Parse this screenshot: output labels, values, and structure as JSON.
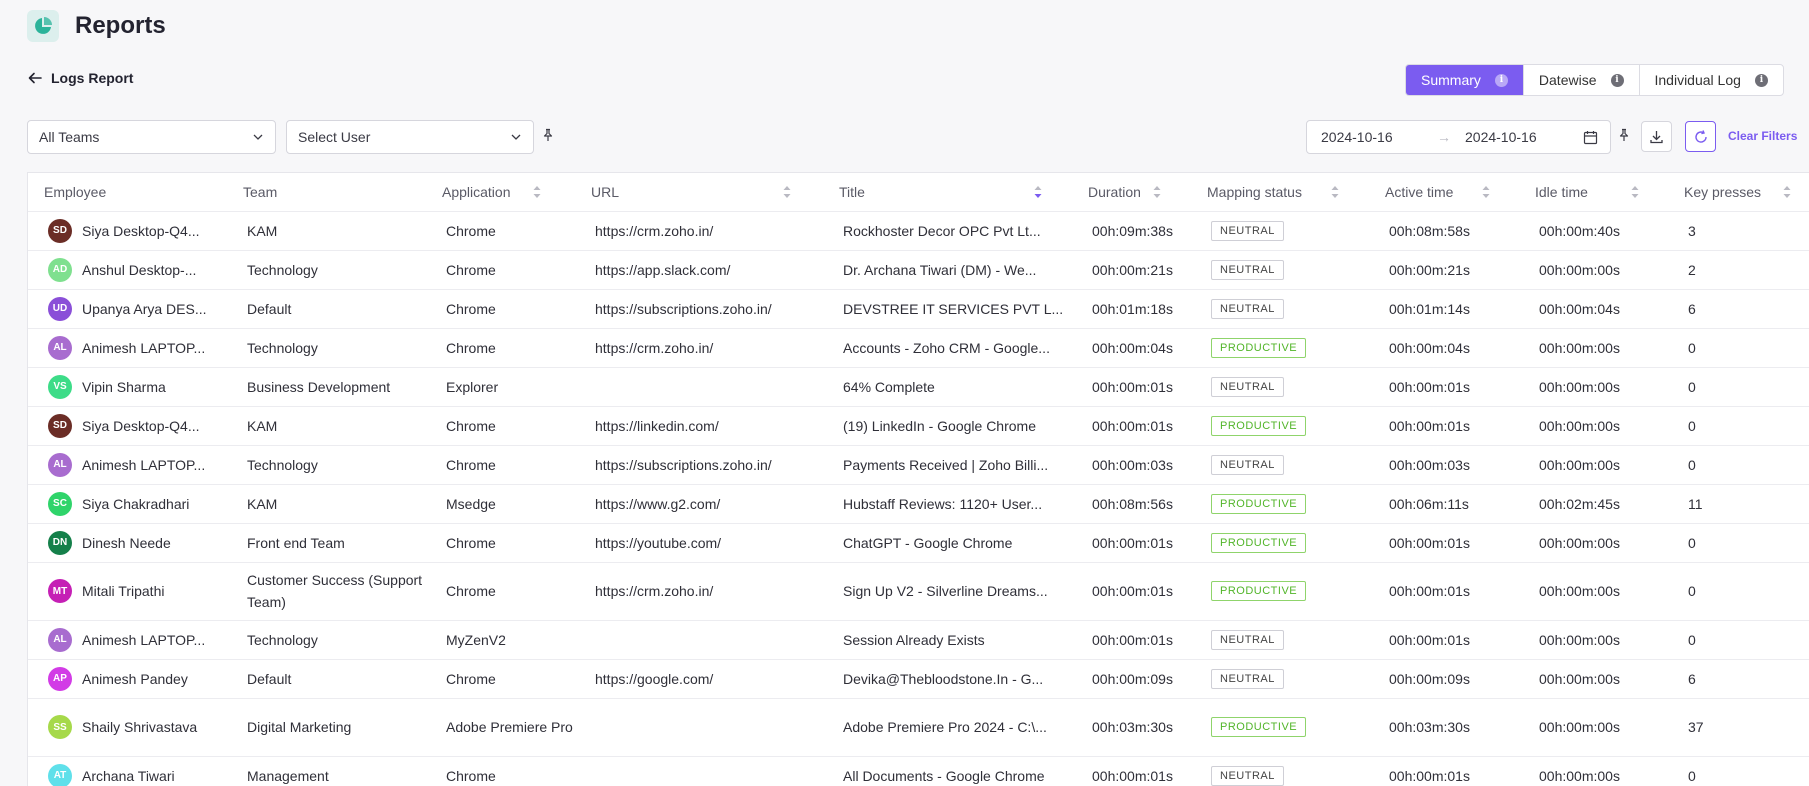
{
  "page": {
    "title": "Reports"
  },
  "back": {
    "label": "Logs Report"
  },
  "views": [
    {
      "label": "Summary",
      "active": true
    },
    {
      "label": "Datewise",
      "active": false
    },
    {
      "label": "Individual Log",
      "active": false
    }
  ],
  "filters": {
    "team": "All Teams",
    "user": "Select User",
    "date_from": "2024-10-16",
    "date_arrow": "→",
    "date_to": "2024-10-16",
    "clear": "Clear Filters"
  },
  "columns": [
    "Employee",
    "Team",
    "Application",
    "URL",
    "Title",
    "Duration",
    "Mapping status",
    "Active time",
    "Idle time",
    "Key presses"
  ],
  "rows": [
    {
      "initials": "SD",
      "avatar_color": "#6b2d26",
      "employee": "Siya Desktop-Q4...",
      "team": "KAM",
      "application": "Chrome",
      "url": "https://crm.zoho.in/",
      "title": "Rockhoster Decor OPC Pvt Lt...",
      "duration": "00h:09m:38s",
      "status": "NEUTRAL",
      "active": "00h:08m:58s",
      "idle": "00h:00m:40s",
      "keys": "3"
    },
    {
      "initials": "AD",
      "avatar_color": "#7fe08f",
      "employee": "Anshul Desktop-...",
      "team": "Technology",
      "application": "Chrome",
      "url": "https://app.slack.com/",
      "title": "Dr. Archana Tiwari (DM) - We...",
      "duration": "00h:00m:21s",
      "status": "NEUTRAL",
      "active": "00h:00m:21s",
      "idle": "00h:00m:00s",
      "keys": "2"
    },
    {
      "initials": "UD",
      "avatar_color": "#8a4fd8",
      "employee": "Upanya Arya DES...",
      "team": "Default",
      "application": "Chrome",
      "url": "https://subscriptions.zoho.in/",
      "title": "DEVSTREE IT SERVICES PVT L...",
      "duration": "00h:01m:18s",
      "status": "NEUTRAL",
      "active": "00h:01m:14s",
      "idle": "00h:00m:04s",
      "keys": "6"
    },
    {
      "initials": "AL",
      "avatar_color": "#a86ccf",
      "employee": "Animesh LAPTOP...",
      "team": "Technology",
      "application": "Chrome",
      "url": "https://crm.zoho.in/",
      "title": "Accounts - Zoho CRM - Google...",
      "duration": "00h:00m:04s",
      "status": "PRODUCTIVE",
      "active": "00h:00m:04s",
      "idle": "00h:00m:00s",
      "keys": "0"
    },
    {
      "initials": "VS",
      "avatar_color": "#3ddc88",
      "employee": "Vipin Sharma",
      "team": "Business Development",
      "application": "Explorer",
      "url": "",
      "title": "64% Complete",
      "duration": "00h:00m:01s",
      "status": "NEUTRAL",
      "active": "00h:00m:01s",
      "idle": "00h:00m:00s",
      "keys": "0"
    },
    {
      "initials": "SD",
      "avatar_color": "#6b2d26",
      "employee": "Siya Desktop-Q4...",
      "team": "KAM",
      "application": "Chrome",
      "url": "https://linkedin.com/",
      "title": "(19) LinkedIn - Google Chrome",
      "duration": "00h:00m:01s",
      "status": "PRODUCTIVE",
      "active": "00h:00m:01s",
      "idle": "00h:00m:00s",
      "keys": "0"
    },
    {
      "initials": "AL",
      "avatar_color": "#a86ccf",
      "employee": "Animesh LAPTOP...",
      "team": "Technology",
      "application": "Chrome",
      "url": "https://subscriptions.zoho.in/",
      "title": "Payments Received | Zoho Billi...",
      "duration": "00h:00m:03s",
      "status": "NEUTRAL",
      "active": "00h:00m:03s",
      "idle": "00h:00m:00s",
      "keys": "0"
    },
    {
      "initials": "SC",
      "avatar_color": "#2fd46a",
      "employee": "Siya Chakradhari",
      "team": "KAM",
      "application": "Msedge",
      "url": "https://www.g2.com/",
      "title": "Hubstaff Reviews: 1120+ User...",
      "duration": "00h:08m:56s",
      "status": "PRODUCTIVE",
      "active": "00h:06m:11s",
      "idle": "00h:02m:45s",
      "keys": "11"
    },
    {
      "initials": "DN",
      "avatar_color": "#15804a",
      "employee": "Dinesh Neede",
      "team": "Front end Team",
      "application": "Chrome",
      "url": "https://youtube.com/",
      "title": "ChatGPT - Google Chrome",
      "duration": "00h:00m:01s",
      "status": "PRODUCTIVE",
      "active": "00h:00m:01s",
      "idle": "00h:00m:00s",
      "keys": "0"
    },
    {
      "initials": "MT",
      "avatar_color": "#c51fb5",
      "employee": "Mitali Tripathi",
      "team": "Customer Success (Support Team)",
      "application": "Chrome",
      "url": "https://crm.zoho.in/",
      "title": "Sign Up V2 - Silverline Dreams...",
      "duration": "00h:00m:01s",
      "status": "PRODUCTIVE",
      "active": "00h:00m:01s",
      "idle": "00h:00m:00s",
      "keys": "0"
    },
    {
      "initials": "AL",
      "avatar_color": "#a86ccf",
      "employee": "Animesh LAPTOP...",
      "team": "Technology",
      "application": "MyZenV2",
      "url": "",
      "title": "Session Already Exists",
      "duration": "00h:00m:01s",
      "status": "NEUTRAL",
      "active": "00h:00m:01s",
      "idle": "00h:00m:00s",
      "keys": "0"
    },
    {
      "initials": "AP",
      "avatar_color": "#d23be6",
      "employee": "Animesh Pandey",
      "team": "Default",
      "application": "Chrome",
      "url": "https://google.com/",
      "title": "Devika@Thebloodstone.In - G...",
      "duration": "00h:00m:09s",
      "status": "NEUTRAL",
      "active": "00h:00m:09s",
      "idle": "00h:00m:00s",
      "keys": "6"
    },
    {
      "initials": "SS",
      "avatar_color": "#a6d94a",
      "employee": "Shaily Shrivastava",
      "team": "Digital Marketing",
      "application": "Adobe Premiere Pro",
      "url": "",
      "title": "Adobe Premiere Pro 2024 - C:\\...",
      "duration": "00h:03m:30s",
      "status": "PRODUCTIVE",
      "active": "00h:03m:30s",
      "idle": "00h:00m:00s",
      "keys": "37"
    },
    {
      "initials": "AT",
      "avatar_color": "#5fe0ea",
      "employee": "Archana Tiwari",
      "team": "Management",
      "application": "Chrome",
      "url": "",
      "title": "All Documents - Google Chrome",
      "duration": "00h:00m:01s",
      "status": "NEUTRAL",
      "active": "00h:00m:01s",
      "idle": "00h:00m:00s",
      "keys": "0"
    }
  ]
}
